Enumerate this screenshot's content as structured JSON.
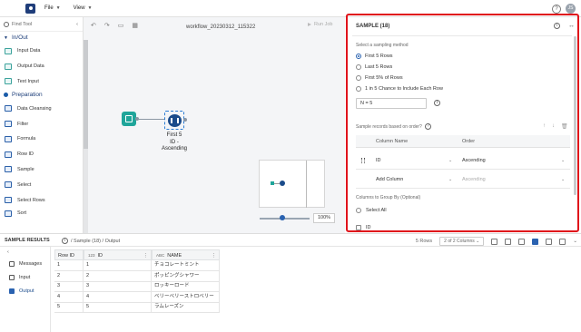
{
  "topbar": {
    "file_label": "File",
    "view_label": "View",
    "avatar_initials": "JS"
  },
  "toolpanel": {
    "search_placeholder": "Find Tool",
    "categories": [
      {
        "label": "In/Out",
        "tools": [
          "Input Data",
          "Output Data",
          "Text Input"
        ]
      },
      {
        "label": "Preparation",
        "tools": [
          "Data Cleansing",
          "Filter",
          "Formula",
          "Row ID",
          "Sample",
          "Select",
          "Select Rows",
          "Sort"
        ]
      }
    ]
  },
  "canvas": {
    "workflow_name": "workflow_20230312_115322",
    "run_job_label": "Run Job",
    "node_label_lines": [
      "First 5",
      "ID -",
      "Ascending"
    ],
    "zoom": "100%"
  },
  "config": {
    "header": "SAMPLE (18)",
    "method_label": "Select a sampling method",
    "methods": [
      "First 5 Rows",
      "Last 5 Rows",
      "First 5% of Rows",
      "1 in 5 Chance to Include Each Row"
    ],
    "selected_method": "First 5 Rows",
    "n_value": "N = 5",
    "sort_label": "Sample records based on order?",
    "sort_table": {
      "col_header": "Column Name",
      "order_header": "Order",
      "rows": [
        {
          "column": "ID",
          "order": "Ascending"
        },
        {
          "column": "Add Column",
          "order": "Ascending"
        }
      ]
    },
    "group_label": "Columns to Group By (Optional)",
    "select_all": "Select All",
    "group_columns": [
      "ID"
    ]
  },
  "results": {
    "title": "SAMPLE RESULTS",
    "breadcrumb": "/ Sample (18) / Output",
    "rows_count": "5 Rows",
    "columns_select": "2 of 2 Columns",
    "side_items": [
      "Messages",
      "Input",
      "Output"
    ],
    "active_side": "Output",
    "grid": {
      "headers": [
        "Row ID",
        "ID",
        "NAME"
      ],
      "header_types": [
        "",
        "123",
        "ABC"
      ],
      "rows": [
        [
          "1",
          "1",
          "チョコレートミント"
        ],
        [
          "2",
          "2",
          "ポッピングシャワー"
        ],
        [
          "3",
          "3",
          "ロッキーロード"
        ],
        [
          "4",
          "4",
          "ベリーベリーストロベリー"
        ],
        [
          "5",
          "5",
          "ラムレーズン"
        ]
      ]
    }
  },
  "colors": {
    "accent": "#2a62b0",
    "highlight": "#e0131b",
    "teal": "#1fa59a",
    "navy": "#1a4b8a"
  }
}
